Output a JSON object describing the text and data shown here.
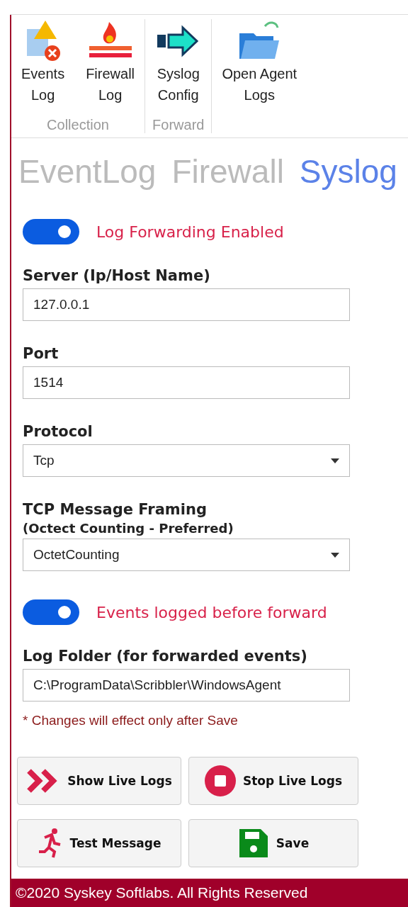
{
  "ribbon": {
    "groups": [
      {
        "label": "Collection",
        "items": [
          {
            "label": "Events\nLog"
          },
          {
            "label": "Firewall\nLog"
          }
        ]
      },
      {
        "label": "Forward",
        "items": [
          {
            "label": "Syslog\nConfig"
          }
        ]
      },
      {
        "items": [
          {
            "label": "Open Agent\nLogs"
          }
        ]
      }
    ]
  },
  "tabs": [
    {
      "label": "EventLog",
      "selected": false
    },
    {
      "label": "Firewall",
      "selected": false
    },
    {
      "label": "Syslog",
      "selected": true
    }
  ],
  "form": [
    {
      "kind": "toggle",
      "label": "Log Forwarding Enabled",
      "on": true
    },
    {
      "kind": "text",
      "label": "Server (Ip/Host Name)",
      "value": "127.0.0.1"
    },
    {
      "kind": "text",
      "label": "Port",
      "value": "1514"
    },
    {
      "kind": "select",
      "label": "Protocol",
      "value": "Tcp"
    },
    {
      "kind": "select",
      "label": "TCP Message Framing",
      "sublabel": "(Octect Counting - Preferred)",
      "value": "OctetCounting"
    },
    {
      "kind": "toggle",
      "label": "Events logged before forward",
      "on": true
    },
    {
      "kind": "text",
      "label": "Log Folder (for forwarded events)",
      "value": "C:\\ProgramData\\Scribbler\\WindowsAgent"
    }
  ],
  "note": "* Changes will effect only after Save",
  "buttons": [
    {
      "label": "Show Live Logs"
    },
    {
      "label": "Stop Live Logs"
    },
    {
      "label": "Test Message"
    },
    {
      "label": "Save"
    }
  ],
  "footer": "©2020 Syskey Softlabs. All Rights Reserved"
}
